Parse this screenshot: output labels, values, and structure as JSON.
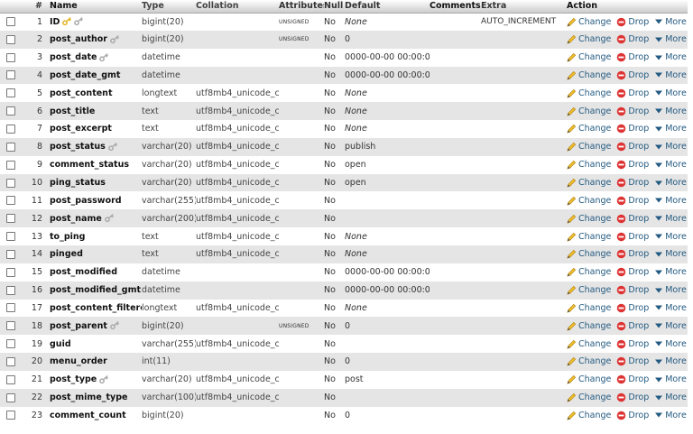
{
  "header": {
    "select": "",
    "number": "#",
    "name": "Name",
    "type": "Type",
    "collation": "Collation",
    "attributes": "Attributes",
    "null": "Null",
    "default": "Default",
    "comments": "Comments",
    "extra": "Extra",
    "action": "Action"
  },
  "actions": {
    "change": "Change",
    "drop": "Drop",
    "more": "More"
  },
  "icons": {
    "change": "pencil-icon",
    "drop": "drop-icon",
    "more": "triangle-down-icon",
    "primary_key": "primary-key-icon",
    "index": "index-key-icon"
  },
  "colors": {
    "link": "#235a81",
    "drop": "#dd3333",
    "primary_key": "#e5b321",
    "index_key": "#aaaaaa",
    "even_row": "#e5e5e5"
  },
  "rows": [
    {
      "num": "1",
      "name": "ID",
      "type": "bigint(20)",
      "collation": "",
      "attributes": "UNSIGNED",
      "null": "No",
      "default": "None",
      "default_italic": true,
      "extra": "AUTO_INCREMENT",
      "keys": [
        "primary",
        "index"
      ]
    },
    {
      "num": "2",
      "name": "post_author",
      "type": "bigint(20)",
      "collation": "",
      "attributes": "UNSIGNED",
      "null": "No",
      "default": "0",
      "default_italic": false,
      "extra": "",
      "keys": [
        "index"
      ]
    },
    {
      "num": "3",
      "name": "post_date",
      "type": "datetime",
      "collation": "",
      "attributes": "",
      "null": "No",
      "default": "0000-00-00 00:00:00",
      "default_italic": false,
      "extra": "",
      "keys": [
        "index"
      ]
    },
    {
      "num": "4",
      "name": "post_date_gmt",
      "type": "datetime",
      "collation": "",
      "attributes": "",
      "null": "No",
      "default": "0000-00-00 00:00:00",
      "default_italic": false,
      "extra": "",
      "keys": []
    },
    {
      "num": "5",
      "name": "post_content",
      "type": "longtext",
      "collation": "utf8mb4_unicode_ci",
      "attributes": "",
      "null": "No",
      "default": "None",
      "default_italic": true,
      "extra": "",
      "keys": []
    },
    {
      "num": "6",
      "name": "post_title",
      "type": "text",
      "collation": "utf8mb4_unicode_ci",
      "attributes": "",
      "null": "No",
      "default": "None",
      "default_italic": true,
      "extra": "",
      "keys": []
    },
    {
      "num": "7",
      "name": "post_excerpt",
      "type": "text",
      "collation": "utf8mb4_unicode_ci",
      "attributes": "",
      "null": "No",
      "default": "None",
      "default_italic": true,
      "extra": "",
      "keys": []
    },
    {
      "num": "8",
      "name": "post_status",
      "type": "varchar(20)",
      "collation": "utf8mb4_unicode_ci",
      "attributes": "",
      "null": "No",
      "default": "publish",
      "default_italic": false,
      "extra": "",
      "keys": [
        "index"
      ]
    },
    {
      "num": "9",
      "name": "comment_status",
      "type": "varchar(20)",
      "collation": "utf8mb4_unicode_ci",
      "attributes": "",
      "null": "No",
      "default": "open",
      "default_italic": false,
      "extra": "",
      "keys": []
    },
    {
      "num": "10",
      "name": "ping_status",
      "type": "varchar(20)",
      "collation": "utf8mb4_unicode_ci",
      "attributes": "",
      "null": "No",
      "default": "open",
      "default_italic": false,
      "extra": "",
      "keys": []
    },
    {
      "num": "11",
      "name": "post_password",
      "type": "varchar(255)",
      "collation": "utf8mb4_unicode_ci",
      "attributes": "",
      "null": "No",
      "default": "",
      "default_italic": false,
      "extra": "",
      "keys": []
    },
    {
      "num": "12",
      "name": "post_name",
      "type": "varchar(200)",
      "collation": "utf8mb4_unicode_ci",
      "attributes": "",
      "null": "No",
      "default": "",
      "default_italic": false,
      "extra": "",
      "keys": [
        "index"
      ]
    },
    {
      "num": "13",
      "name": "to_ping",
      "type": "text",
      "collation": "utf8mb4_unicode_ci",
      "attributes": "",
      "null": "No",
      "default": "None",
      "default_italic": true,
      "extra": "",
      "keys": []
    },
    {
      "num": "14",
      "name": "pinged",
      "type": "text",
      "collation": "utf8mb4_unicode_ci",
      "attributes": "",
      "null": "No",
      "default": "None",
      "default_italic": true,
      "extra": "",
      "keys": []
    },
    {
      "num": "15",
      "name": "post_modified",
      "type": "datetime",
      "collation": "",
      "attributes": "",
      "null": "No",
      "default": "0000-00-00 00:00:00",
      "default_italic": false,
      "extra": "",
      "keys": []
    },
    {
      "num": "16",
      "name": "post_modified_gmt",
      "type": "datetime",
      "collation": "",
      "attributes": "",
      "null": "No",
      "default": "0000-00-00 00:00:00",
      "default_italic": false,
      "extra": "",
      "keys": []
    },
    {
      "num": "17",
      "name": "post_content_filtered",
      "type": "longtext",
      "collation": "utf8mb4_unicode_ci",
      "attributes": "",
      "null": "No",
      "default": "None",
      "default_italic": true,
      "extra": "",
      "keys": []
    },
    {
      "num": "18",
      "name": "post_parent",
      "type": "bigint(20)",
      "collation": "",
      "attributes": "UNSIGNED",
      "null": "No",
      "default": "0",
      "default_italic": false,
      "extra": "",
      "keys": [
        "index"
      ]
    },
    {
      "num": "19",
      "name": "guid",
      "type": "varchar(255)",
      "collation": "utf8mb4_unicode_ci",
      "attributes": "",
      "null": "No",
      "default": "",
      "default_italic": false,
      "extra": "",
      "keys": []
    },
    {
      "num": "20",
      "name": "menu_order",
      "type": "int(11)",
      "collation": "",
      "attributes": "",
      "null": "No",
      "default": "0",
      "default_italic": false,
      "extra": "",
      "keys": []
    },
    {
      "num": "21",
      "name": "post_type",
      "type": "varchar(20)",
      "collation": "utf8mb4_unicode_ci",
      "attributes": "",
      "null": "No",
      "default": "post",
      "default_italic": false,
      "extra": "",
      "keys": [
        "index"
      ]
    },
    {
      "num": "22",
      "name": "post_mime_type",
      "type": "varchar(100)",
      "collation": "utf8mb4_unicode_ci",
      "attributes": "",
      "null": "No",
      "default": "",
      "default_italic": false,
      "extra": "",
      "keys": []
    },
    {
      "num": "23",
      "name": "comment_count",
      "type": "bigint(20)",
      "collation": "",
      "attributes": "",
      "null": "No",
      "default": "0",
      "default_italic": false,
      "extra": "",
      "keys": []
    }
  ]
}
